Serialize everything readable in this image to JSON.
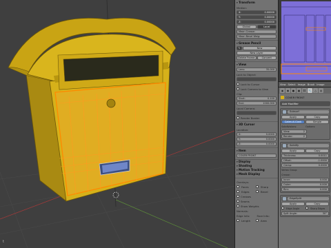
{
  "viewport": {
    "view_label": "t"
  },
  "transform": {
    "title": "Transform",
    "median": "Median:",
    "x": {
      "label": "X:",
      "value": "0.00000"
    },
    "y": {
      "label": "Y:",
      "value": "0.00000"
    },
    "z": {
      "label": "Z:",
      "value": "0.00000"
    },
    "global": "Global",
    "local": "Local",
    "mean_crease": "Mean Crease:",
    "mean_bevel": "Mean Bevel Weig:"
  },
  "grease_pencil": {
    "title": "Grease Pencil",
    "new": "New",
    "new_layer": "New Layer",
    "delete_frame": "Delete Frame",
    "convert": "Convert"
  },
  "view": {
    "title": "View",
    "lens": {
      "label": "Lens:",
      "value": "35.000"
    },
    "lock_to_object": "Lock to Object:",
    "lock_to_cursor": "Lock to Cursor",
    "lock_camera": "Lock Camera to View",
    "clip": "Clip:",
    "start": {
      "label": "Start:",
      "value": "0.100"
    },
    "end": {
      "label": "End:",
      "value": "1000.000"
    },
    "local_camera": "Local Camera:",
    "render_border": "Render Border"
  },
  "cursor": {
    "title": "3D Cursor",
    "location": "Location:",
    "x": {
      "label": "X:",
      "value": "0.0000"
    },
    "y": {
      "label": "Y:",
      "value": "0.0000"
    },
    "z": {
      "label": "Z:",
      "value": "0.0000"
    }
  },
  "item": {
    "title": "Item",
    "name": "COVER FRONT"
  },
  "collapsed": [
    "Display",
    "Shading",
    "Motion Tracking",
    "Mesh Display"
  ],
  "overlays": {
    "label": "Overlays:",
    "faces": "Faces",
    "edges": "Edges",
    "creases": "Creases",
    "seams": "Seams",
    "sharp": "Sharp",
    "bevel": "Bevel",
    "show_weights": "Show Weights",
    "normals": "Normals:",
    "edge_info": "Edge Info:",
    "face_info": "Face Info:",
    "length": "Length",
    "area": "Area"
  },
  "right": {
    "menu": [
      "View",
      "Select",
      "Image",
      "Brush",
      "Image"
    ],
    "object_path": "COVER FRONT",
    "add_modifier": "Add Modifier",
    "modifiers": [
      {
        "name": "Subsurf",
        "apply": "Apply",
        "copy": "Copy",
        "tabs": [
          "Catmull-Clark",
          "Simple"
        ],
        "rows": [
          [
            "Subdivisions:",
            "Options:"
          ],
          [
            "View:",
            "2"
          ],
          [
            "Render:",
            "2"
          ]
        ]
      },
      {
        "name": "Solidify",
        "apply": "Apply",
        "copy": "Copy",
        "rows": [
          [
            "Thickness:",
            "0.0011"
          ],
          [
            "Offset:",
            "-1.0000"
          ],
          [
            "Clamp:",
            "0.0000"
          ],
          [
            "Vertex Group:",
            ""
          ],
          [
            "Crease:",
            ""
          ],
          [
            "Inner:",
            "0.000"
          ],
          [
            "Outer:",
            "0.000"
          ],
          [
            "Rim:",
            "0.000"
          ]
        ]
      },
      {
        "name": "EdgeSplit",
        "apply": "Apply",
        "copy": "Copy",
        "rows": [
          [
            "Edge Angle",
            "Sharp Edges"
          ],
          [
            "Split Angle:",
            "30°"
          ]
        ]
      }
    ]
  },
  "colors": {
    "mailbox": "#d6b11a",
    "mailbox_dark": "#8f7410",
    "selection": "#ff8a00",
    "grid_red": "#a23a3a",
    "grid_green": "#5c8c3a",
    "preview_panel": "#7d6fd8"
  }
}
